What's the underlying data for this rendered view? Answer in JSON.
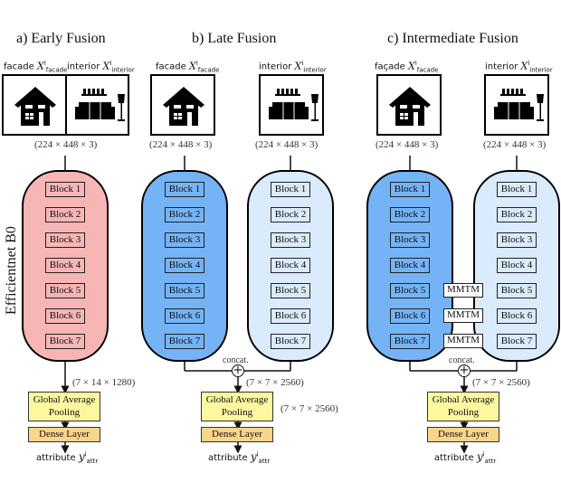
{
  "panels": {
    "early": {
      "title": "a) Early Fusion",
      "input_facade_label": "facade",
      "input_interior_label": "interior",
      "input_dims": "(224 × 448 × 3)",
      "backbone_color": "#f7b5b5",
      "blocks": [
        "Block 1",
        "Block 2",
        "Block 3",
        "Block 4",
        "Block 5",
        "Block 6",
        "Block 7"
      ],
      "feature_dims": "(7 × 14 × 1280)",
      "pooling_label": "Global Average Pooling",
      "dense_label": "Dense Layer",
      "output_label": "attribute"
    },
    "late": {
      "title": "b) Late Fusion",
      "input_facade_label": "facade",
      "input_interior_label": "interior",
      "input_dims_facade": "(224 × 448 × 3)",
      "input_dims_interior": "(224 × 448 × 3)",
      "facade_backbone_color": "#74b3f5",
      "interior_backbone_color": "#d9ebfc",
      "blocks": [
        "Block 1",
        "Block 2",
        "Block 3",
        "Block 4",
        "Block 5",
        "Block 6",
        "Block 7"
      ],
      "concat_label": "concat.",
      "concat_dims": "(7 × 7 × 2560)",
      "pooling_label": "Global Average Pooling",
      "pooling_dims": "(7 × 7 × 2560)",
      "dense_label": "Dense Layer",
      "output_label": "attribute"
    },
    "intermediate": {
      "title": "c) Intermediate Fusion",
      "input_facade_label": "façade",
      "input_interior_label": "interior",
      "input_dims_facade": "(224 × 448 × 3)",
      "input_dims_interior": "(224 × 448 × 3)",
      "blocks": [
        "Block 1",
        "Block 2",
        "Block 3",
        "Block 4",
        "Block 5",
        "Block 6",
        "Block 7"
      ],
      "mmtm_label": "MMTM",
      "concat_label": "concat.",
      "concat_dims": "(7 × 7 × 2560)",
      "pooling_label": "Global Average Pooling",
      "dense_label": "Dense Layer",
      "output_label": "attribute"
    }
  },
  "side_label": "Efficientnet B0",
  "symbols": {
    "x": "X",
    "x_sup": "i",
    "facade_sub": "facade",
    "interior_sub": "interior",
    "y": "y",
    "y_sup": "i",
    "attr_sub": "attr",
    "plus": "+"
  },
  "colors": {
    "early_fill": "#f7b5b5",
    "facade_fill": "#74b3f5",
    "interior_fill": "#d9ebfc",
    "pooling_fill": "#fdf7a0",
    "dense_fill": "#fbd58b"
  }
}
